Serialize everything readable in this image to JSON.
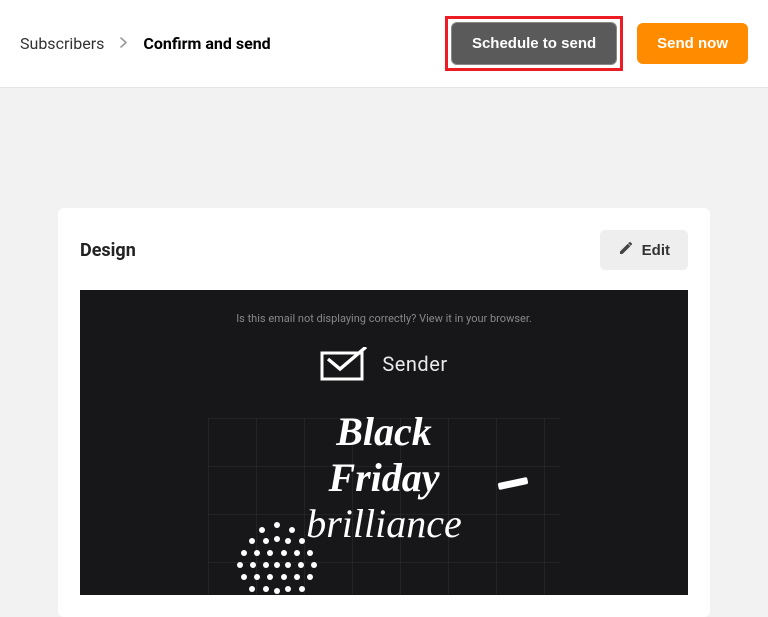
{
  "header": {
    "breadcrumb": {
      "item1": "Subscribers",
      "item2": "Confirm and send"
    },
    "actions": {
      "schedule_label": "Schedule to send",
      "send_now_label": "Send now"
    }
  },
  "card": {
    "title": "Design",
    "edit_label": "Edit"
  },
  "preview": {
    "meta_text": "Is this email not displaying correctly? View it in your browser.",
    "sender_name": "Sender",
    "hero_line1": "Black",
    "hero_line2": "Friday",
    "hero_line3": "brilliance"
  }
}
